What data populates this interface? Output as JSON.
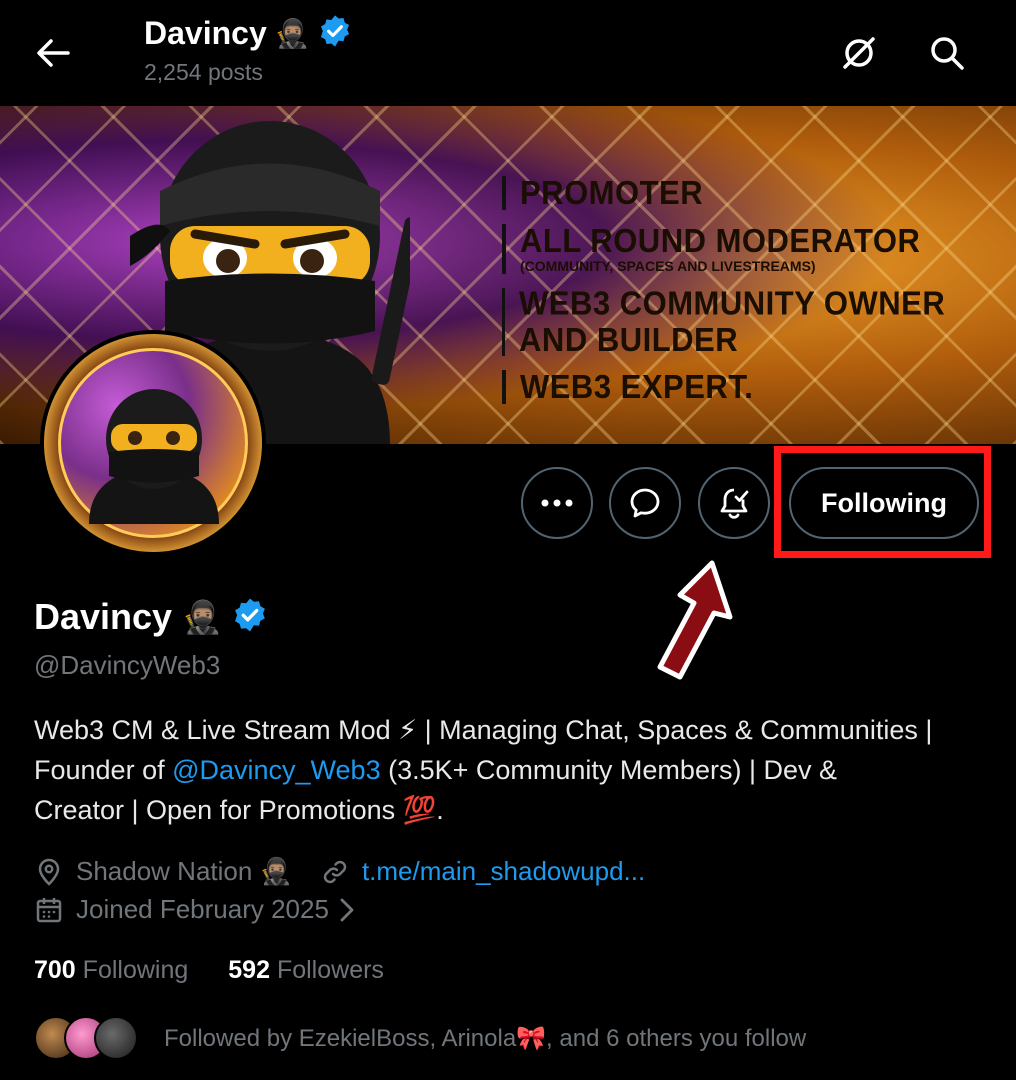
{
  "header": {
    "title": "Davincy",
    "title_emoji": "🥷🏽",
    "posts": "2,254 posts"
  },
  "banner": {
    "lines": [
      {
        "text": "PROMOTER",
        "sub": ""
      },
      {
        "text": "ALL ROUND MODERATOR",
        "sub": "(COMMUNITY, SPACES AND LIVESTREAMS)"
      },
      {
        "text": "WEB3 COMMUNITY OWNER AND BUILDER",
        "sub": ""
      },
      {
        "text": "WEB3 EXPERT.",
        "sub": ""
      }
    ]
  },
  "actions": {
    "following_label": "Following"
  },
  "profile": {
    "name": "Davincy",
    "name_emoji": "🥷🏽",
    "handle": "@DavincyWeb3",
    "bio_part1": "Web3 CM & Live Stream Mod ⚡ | Managing Chat, Spaces & Communities | Founder of ",
    "bio_mention": "@Davincy_Web3",
    "bio_part2": " (3.5K+ Community Members) | Dev & Creator | Open for Promotions 💯.",
    "location": "Shadow Nation 🥷🏽",
    "website": "t.me/main_shadowupd...",
    "joined": "Joined February 2025"
  },
  "stats": {
    "following_count": "700",
    "following_label": "Following",
    "followers_count": "592",
    "followers_label": "Followers"
  },
  "followed_by": "Followed by EzekielBoss, Arinola🎀, and 6 others you follow",
  "colors": {
    "accent": "#1d9bf0",
    "highlight": "#ff1a1a",
    "muted": "#71767b"
  }
}
